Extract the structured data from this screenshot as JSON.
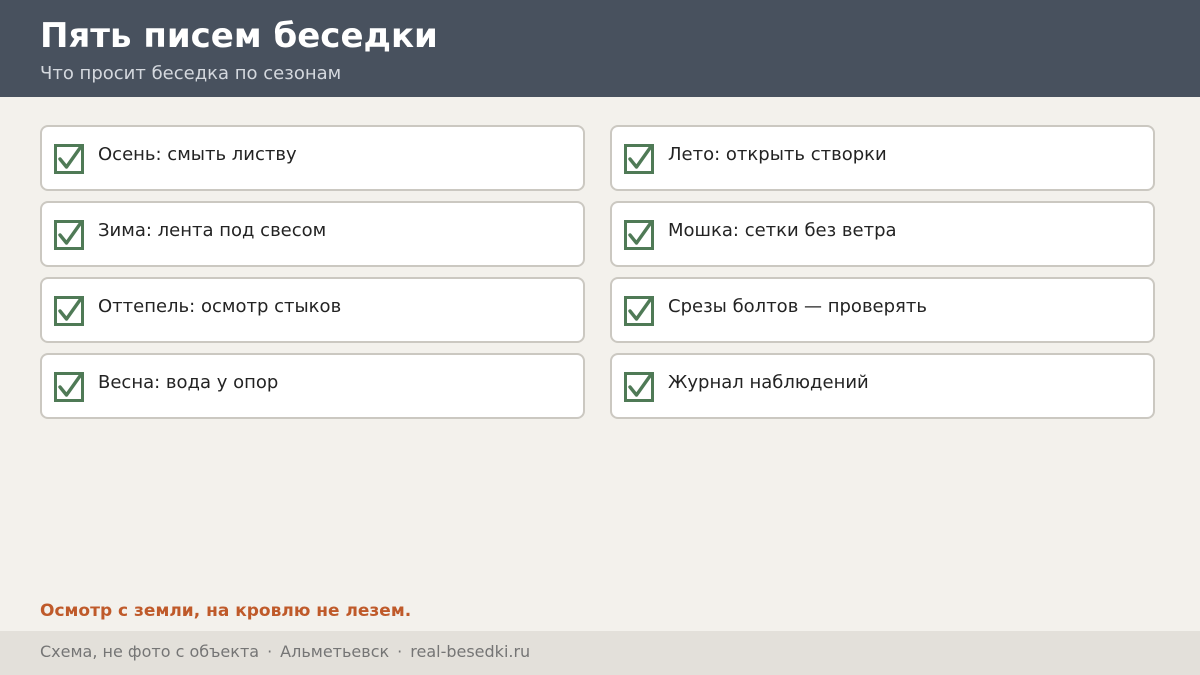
{
  "header": {
    "title": "Пять писем беседки",
    "subtitle": "Что просит беседка по сезонам"
  },
  "checklist": {
    "left": [
      {
        "label": "Осень: смыть листву",
        "checked": true
      },
      {
        "label": "Зима: лента под свесом",
        "checked": true
      },
      {
        "label": "Оттепель: осмотр стыков",
        "checked": true
      },
      {
        "label": "Весна: вода у опор",
        "checked": true
      }
    ],
    "right": [
      {
        "label": "Лето: открыть створки",
        "checked": true
      },
      {
        "label": "Мошка: сетки без ветра",
        "checked": true
      },
      {
        "label": "Срезы болтов — проверять",
        "checked": true
      },
      {
        "label": "Журнал наблюдений",
        "checked": true
      }
    ]
  },
  "note": "Осмотр с земли, на кровлю не лезем.",
  "footer": {
    "caption": "Схема, не фото с объекта",
    "separator": "·",
    "city": "Альметьевск",
    "site": "real-besedki.ru"
  },
  "colors": {
    "header_bg": "#48515e",
    "accent_check": "#4f7a56",
    "note": "#bf5a2a"
  },
  "icons": {
    "checkbox": "checkbox-checked-icon"
  }
}
